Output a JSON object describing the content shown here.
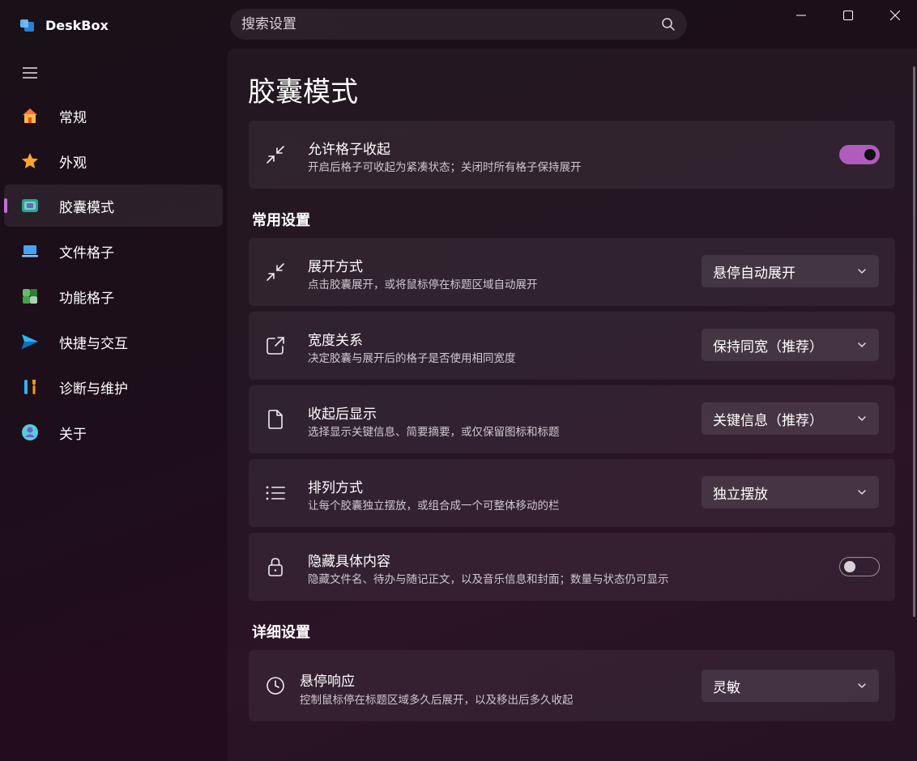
{
  "app": {
    "title": "DeskBox"
  },
  "search": {
    "placeholder": "搜索设置"
  },
  "sidebar": {
    "items": [
      {
        "label": "常规",
        "icon": "home-icon"
      },
      {
        "label": "外观",
        "icon": "star-icon"
      },
      {
        "label": "胶囊模式",
        "icon": "capsule-icon",
        "active": true
      },
      {
        "label": "文件格子",
        "icon": "laptop-icon"
      },
      {
        "label": "功能格子",
        "icon": "grid-icon"
      },
      {
        "label": "快捷与交互",
        "icon": "send-icon"
      },
      {
        "label": "诊断与维护",
        "icon": "tools-icon"
      },
      {
        "label": "关于",
        "icon": "info-icon"
      }
    ]
  },
  "main": {
    "title": "胶囊模式",
    "top_card": {
      "title": "允许格子收起",
      "desc": "开启后格子可收起为紧凑状态；关闭时所有格子保持展开",
      "toggle_on": true
    },
    "common_section": {
      "title": "常用设置",
      "cards": [
        {
          "title": "展开方式",
          "desc": "点击胶囊展开，或将鼠标停在标题区域自动展开",
          "value": "悬停自动展开",
          "icon": "collapse-arrows-icon"
        },
        {
          "title": "宽度关系",
          "desc": "决定胶囊与展开后的格子是否使用相同宽度",
          "value": "保持同宽（推荐）",
          "icon": "open-external-icon"
        },
        {
          "title": "收起后显示",
          "desc": "选择显示关键信息、简要摘要，或仅保留图标和标题",
          "value": "关键信息（推荐）",
          "icon": "document-icon"
        },
        {
          "title": "排列方式",
          "desc": "让每个胶囊独立摆放，或组合成一个可整体移动的栏",
          "value": "独立摆放",
          "icon": "list-icon"
        }
      ],
      "hide_card": {
        "title": "隐藏具体内容",
        "desc": "隐藏文件名、待办与随记正文，以及音乐信息和封面；数量与状态仍可显示",
        "toggle_on": false
      }
    },
    "detail_section": {
      "title": "详细设置",
      "card": {
        "title": "悬停响应",
        "desc": "控制鼠标停在标题区域多久后展开，以及移出后多久收起",
        "value": "灵敏"
      }
    }
  },
  "colors": {
    "accent": "#b05cbf",
    "indicator": "#c76bd6"
  }
}
